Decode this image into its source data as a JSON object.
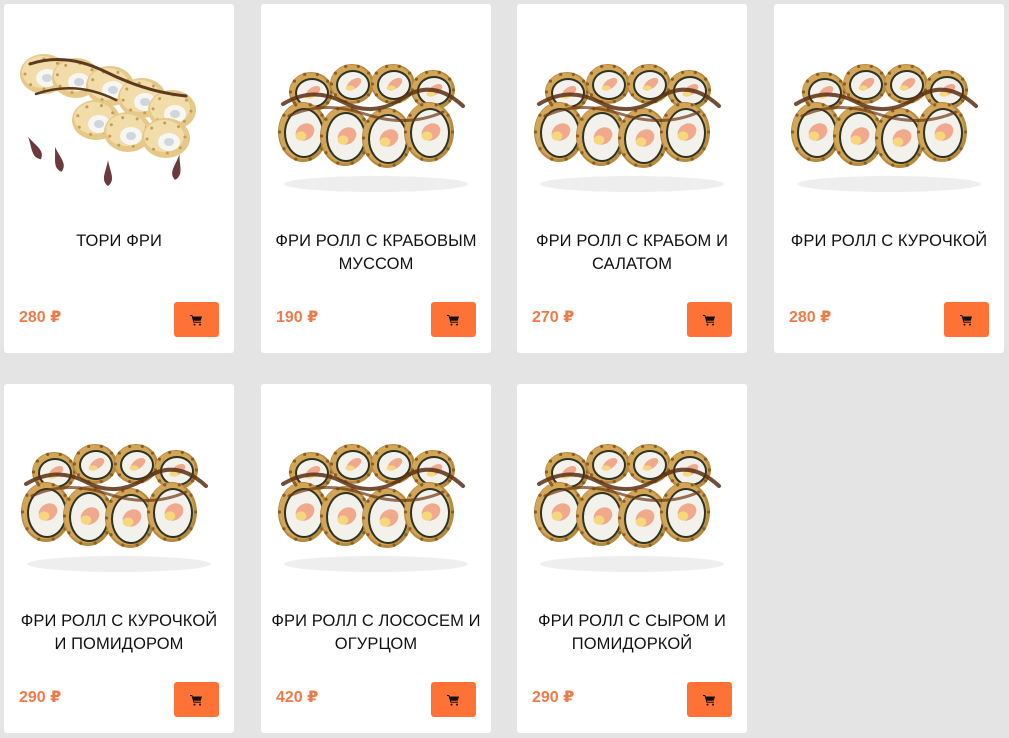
{
  "accent_color": "#ff7236",
  "price_color": "#f07a47",
  "products": [
    {
      "name": "ТОРИ ФРИ",
      "price": "280 ₽",
      "image": "tori-roll-icon"
    },
    {
      "name": "ФРИ РОЛЛ С КРАБОВЫМ МУССОМ",
      "price": "190 ₽",
      "image": "fried-roll-icon"
    },
    {
      "name": "ФРИ РОЛЛ С КРАБОМ И САЛАТОМ",
      "price": "270 ₽",
      "image": "fried-roll-icon"
    },
    {
      "name": "ФРИ РОЛЛ С КУРОЧКОЙ",
      "price": "280 ₽",
      "image": "fried-roll-icon"
    },
    {
      "name": "ФРИ РОЛЛ С КУРОЧКОЙ И ПОМИДОРОМ",
      "price": "290 ₽",
      "image": "fried-roll-icon"
    },
    {
      "name": "ФРИ РОЛЛ С ЛОСОСЕМ И ОГУРЦОМ",
      "price": "420 ₽",
      "image": "fried-roll-icon"
    },
    {
      "name": "ФРИ РОЛЛ С СЫРОМ И ПОМИДОРКОЙ",
      "price": "290 ₽",
      "image": "fried-roll-icon"
    }
  ],
  "cart_icon": "shopping-cart-icon"
}
